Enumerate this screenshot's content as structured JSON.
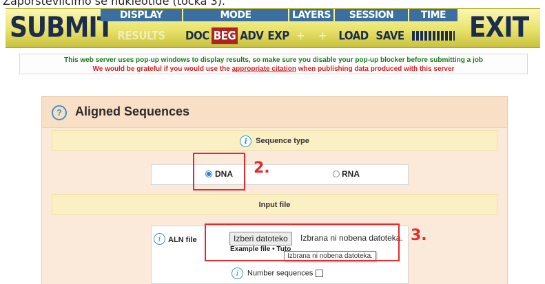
{
  "caption": "Zaporštevilčimo se nukleotide (točka 3).",
  "toolbar": {
    "submit": "SUBMIT",
    "exit": "EXIT",
    "groups": [
      {
        "title": "DISPLAY",
        "items": [
          {
            "label": "RESULTS"
          }
        ]
      },
      {
        "title": "MODE",
        "items": [
          {
            "label": "DOC"
          },
          {
            "label": "BEG"
          },
          {
            "label": "ADV"
          },
          {
            "label": "EXP"
          }
        ]
      },
      {
        "title": "LAYERS",
        "items": [
          {
            "label": "+"
          },
          {
            "label": "+"
          }
        ]
      },
      {
        "title": "SESSION",
        "items": [
          {
            "label": "LOAD"
          },
          {
            "label": "SAVE"
          }
        ]
      },
      {
        "title": "TIME"
      }
    ]
  },
  "notice": {
    "line1": "This web server uses pop-up windows to display results, so make sure you disable your pop-up blocker before submitting a job",
    "line2_pre": "We would be grateful if you would use the ",
    "line2_link": "appropriate citation",
    "line2_post": " when publishing data produced with this server"
  },
  "panel": {
    "title": "Aligned Sequences",
    "help_icon": "question-icon",
    "sequence_type": {
      "heading": "Sequence type",
      "options": [
        {
          "label": "DNA",
          "selected": true
        },
        {
          "label": "RNA",
          "selected": false
        }
      ]
    },
    "input_file": {
      "heading": "Input file",
      "label": "ALN file",
      "button": "Izberi datoteko",
      "status": "Izbrana ni nobena datoteka.",
      "links": "Example file • Tuto",
      "tooltip": "Izbrana ni nobena datoteka.",
      "number_sequences": "Number sequences",
      "number_sequences_checked": false
    }
  },
  "annotations": {
    "step2": "2.",
    "step3": "3."
  },
  "colors": {
    "accent_red": "#e8282a",
    "toolbar_blue": "#3a6fa0",
    "active_mode": "#b02323"
  }
}
